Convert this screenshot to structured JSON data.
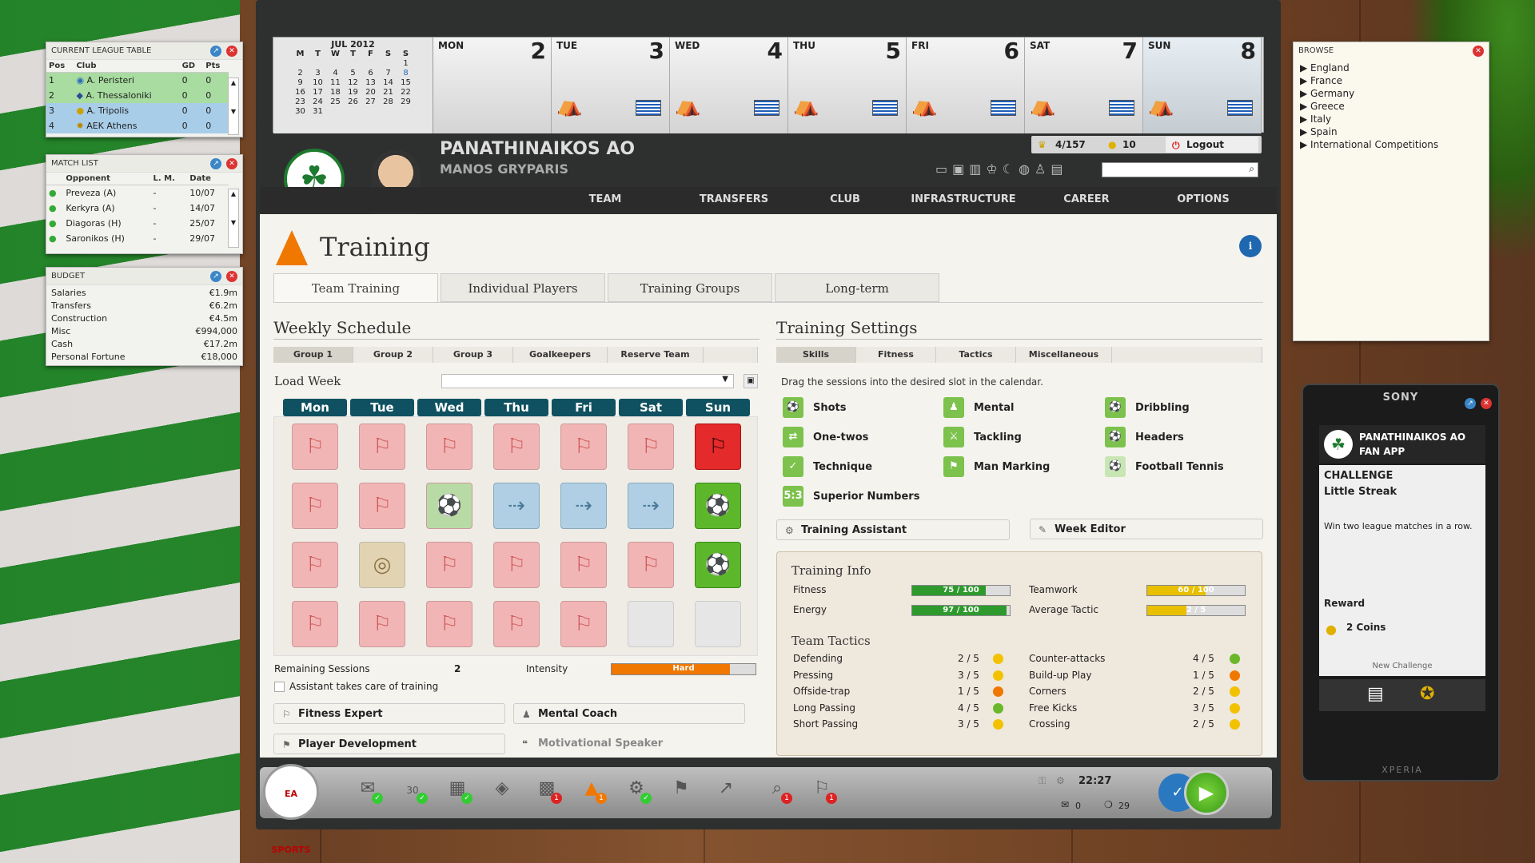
{
  "league_table": {
    "title": "CURRENT LEAGUE TABLE",
    "columns": [
      "Pos",
      "Club",
      "GD",
      "Pts"
    ],
    "rows": [
      {
        "pos": "1",
        "club": "A. Peristeri",
        "gd": "0",
        "pts": "0"
      },
      {
        "pos": "2",
        "club": "A. Thessaloniki",
        "gd": "0",
        "pts": "0"
      },
      {
        "pos": "3",
        "club": "A. Tripolis",
        "gd": "0",
        "pts": "0"
      },
      {
        "pos": "4",
        "club": "AEK Athens",
        "gd": "0",
        "pts": "0"
      }
    ]
  },
  "match_list": {
    "title": "MATCH LIST",
    "columns": [
      "Opponent",
      "L. M.",
      "Date"
    ],
    "rows": [
      {
        "opponent": "Preveza (A)",
        "lm": "-",
        "date": "10/07"
      },
      {
        "opponent": "Kerkyra (A)",
        "lm": "-",
        "date": "14/07"
      },
      {
        "opponent": "Diagoras (H)",
        "lm": "-",
        "date": "25/07"
      },
      {
        "opponent": "Saronikos (H)",
        "lm": "-",
        "date": "29/07"
      }
    ]
  },
  "budget": {
    "title": "BUDGET",
    "rows": [
      {
        "label": "Salaries",
        "value": "€1.9m"
      },
      {
        "label": "Transfers",
        "value": "€6.2m"
      },
      {
        "label": "Construction",
        "value": "€4.5m"
      },
      {
        "label": "Misc",
        "value": "€994,000"
      },
      {
        "label": "Cash",
        "value": "€17.2m"
      },
      {
        "label": "Personal Fortune",
        "value": "€18,000"
      }
    ]
  },
  "calendar": {
    "month": "JUL 2012",
    "weekday_letters": [
      "M",
      "T",
      "W",
      "T",
      "F",
      "S",
      "S"
    ],
    "mini_days": [
      "",
      "",
      "",
      "",
      "",
      "",
      "1",
      "2",
      "3",
      "4",
      "5",
      "6",
      "7",
      "8",
      "9",
      "10",
      "11",
      "12",
      "13",
      "14",
      "15",
      "16",
      "17",
      "18",
      "19",
      "20",
      "21",
      "22",
      "23",
      "24",
      "25",
      "26",
      "27",
      "28",
      "29",
      "30",
      "31"
    ],
    "days": [
      {
        "name": "MON",
        "num": "2"
      },
      {
        "name": "TUE",
        "num": "3"
      },
      {
        "name": "WED",
        "num": "4"
      },
      {
        "name": "THU",
        "num": "5"
      },
      {
        "name": "FRI",
        "num": "6"
      },
      {
        "name": "SAT",
        "num": "7"
      },
      {
        "name": "SUN",
        "num": "8"
      }
    ]
  },
  "header": {
    "club": "PANATHINAIKOS AO",
    "manager": "MANOS GRYPARIS",
    "rank": "4/157",
    "coins": "10",
    "logout": "Logout",
    "search_placeholder": ""
  },
  "nav": [
    "TEAM",
    "TRANSFERS",
    "CLUB",
    "INFRASTRUCTURE",
    "CAREER",
    "OPTIONS"
  ],
  "page": {
    "title": "Training",
    "info": "i",
    "tabs": [
      "Team Training",
      "Individual Players",
      "Training Groups",
      "Long-term"
    ]
  },
  "schedule": {
    "title": "Weekly Schedule",
    "groups": [
      "Group 1",
      "Group 2",
      "Group 3",
      "Goalkeepers",
      "Reserve Team"
    ],
    "load_week": "Load Week",
    "days": [
      "Mon",
      "Tue",
      "Wed",
      "Thu",
      "Fri",
      "Sat",
      "Sun"
    ],
    "remaining_label": "Remaining Sessions",
    "remaining_value": "2",
    "intensity_label": "Intensity",
    "intensity_value": "Hard",
    "intensity_level": 0.82,
    "assistant_label": "Assistant takes care of training",
    "buttons": [
      "Fitness Expert",
      "Mental Coach",
      "Player Development",
      "Motivational Speaker"
    ]
  },
  "settings": {
    "title": "Training Settings",
    "tabs": [
      "Skills",
      "Fitness",
      "Tactics",
      "Miscellaneous"
    ],
    "hint": "Drag the sessions into the desired slot in the calendar.",
    "skills": [
      "Shots",
      "Mental",
      "Dribbling",
      "One-twos",
      "Tackling",
      "Headers",
      "Technique",
      "Man Marking",
      "Football Tennis",
      "Superior Numbers"
    ],
    "assistant_btn": "Training Assistant",
    "editor_btn": "Week Editor"
  },
  "training_info": {
    "title": "Training Info",
    "fitness_label": "Fitness",
    "fitness_value": "75 / 100",
    "fitness_level": 0.75,
    "energy_label": "Energy",
    "energy_value": "97 / 100",
    "energy_level": 0.97,
    "teamwork_label": "Teamwork",
    "teamwork_value": "60 / 100",
    "teamwork_level": 0.6,
    "avgtactic_label": "Average Tactic",
    "avgtactic_value": "2 / 5",
    "avgtactic_level": 0.4,
    "tactics_title": "Team Tactics",
    "tactics_left": [
      {
        "label": "Defending",
        "value": "2 / 5",
        "color": "#f2c200"
      },
      {
        "label": "Pressing",
        "value": "3 / 5",
        "color": "#f2c200"
      },
      {
        "label": "Offside-trap",
        "value": "1 / 5",
        "color": "#f07800"
      },
      {
        "label": "Long Passing",
        "value": "4 / 5",
        "color": "#6ab82a"
      },
      {
        "label": "Short Passing",
        "value": "3 / 5",
        "color": "#f2c200"
      }
    ],
    "tactics_right": [
      {
        "label": "Counter-attacks",
        "value": "4 / 5",
        "color": "#6ab82a"
      },
      {
        "label": "Build-up Play",
        "value": "1 / 5",
        "color": "#f07800"
      },
      {
        "label": "Corners",
        "value": "2 / 5",
        "color": "#f2c200"
      },
      {
        "label": "Free Kicks",
        "value": "3 / 5",
        "color": "#f2c200"
      },
      {
        "label": "Crossing",
        "value": "2 / 5",
        "color": "#f2c200"
      }
    ]
  },
  "browse": {
    "title": "BROWSE",
    "items": [
      "England",
      "France",
      "Germany",
      "Greece",
      "Italy",
      "Spain",
      "International Competitions"
    ]
  },
  "phone": {
    "brand": "SONY",
    "club": "PANATHINAIKOS AO",
    "app": "FAN APP",
    "challenge": "CHALLENGE",
    "challenge_name": "Little Streak",
    "challenge_desc": "Win two league matches in a row.",
    "reward": "Reward",
    "reward_value": "2 Coins",
    "new_challenge": "New Challenge",
    "model": "XPERIA"
  },
  "bottombar": {
    "logo": "EA SPORTS",
    "time": "22:27",
    "mails": "0",
    "messages": "29",
    "cal_day": "30"
  },
  "colors": {
    "nav_bg": "#2b2b2b",
    "dayhead": "#0f5160",
    "green": "#5cb82a",
    "red": "#e42a2a"
  }
}
